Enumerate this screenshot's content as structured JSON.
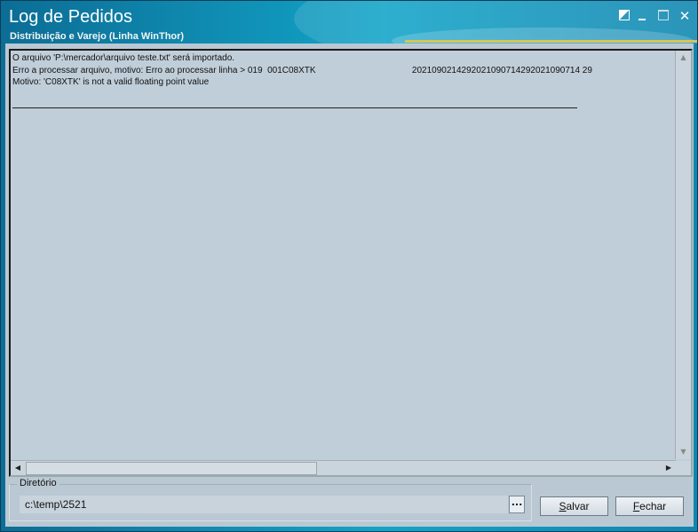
{
  "window": {
    "title": "Log de Pedidos",
    "subtitle": "Distribuição e Varejo (Linha WinThor)",
    "controls": [
      "restore-icon",
      "minimize-icon",
      "maximize-icon",
      "close-icon"
    ]
  },
  "log": {
    "lines": [
      "O arquivo 'P:\\mercador\\arquivo teste.txt' será importado.",
      "Erro a processar arquivo, motivo: Erro ao processar linha > 019  001C08XTK                                       2021090214292021090714292021090714 29",
      "Motivo: 'C08XTK' is not a valid floating point value"
    ]
  },
  "directory": {
    "label": "Diretório",
    "value": "c:\\temp\\2521",
    "browse_label": "..."
  },
  "buttons": {
    "save_first": "S",
    "save_rest": "alvar",
    "close_first": "F",
    "close_rest": "echar"
  },
  "colors": {
    "title_bar": "#12a4c8",
    "client_bg": "#bac8d4",
    "accent_line": "#d8c45a"
  }
}
